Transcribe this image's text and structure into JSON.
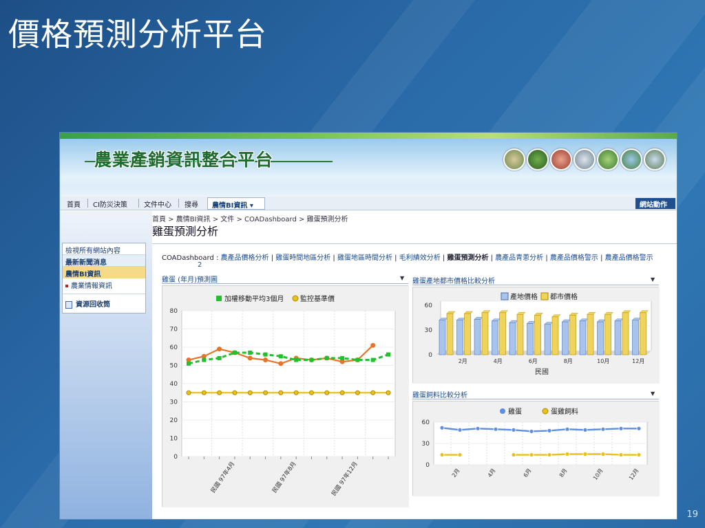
{
  "slide": {
    "title": "價格預測分析平台",
    "page_number": "19"
  },
  "site": {
    "title": "農業產銷資訊整合平台",
    "site_actions_label": "網站動作",
    "nav": [
      "首頁",
      "CI防災決策",
      "文件中心",
      "搜尋"
    ],
    "nav_active": "農情BI資訊 ▾"
  },
  "quicklaunch": {
    "view_all": "檢視所有網站內容",
    "latest_news": "最新新聞消息",
    "bi_info": "農情BI資訊",
    "bi_sub": "農業情報資訊",
    "recycle": "資源回收筒"
  },
  "page": {
    "breadcrumb": "首頁 > 農情BI資訊 > 文件 > COADashboard > 雞蛋預測分析",
    "title": "雞蛋預測分析"
  },
  "coa_bar": {
    "prefix": "COADashboard :",
    "links": [
      "農產品價格分析",
      "雞蛋時間地區分析",
      "雞蛋地區時間分析",
      "毛利績效分析",
      "雞蛋預測分析",
      "農產品青蔥分析",
      "農產品價格警示",
      "農產品價格警示"
    ],
    "current_index": 4,
    "overflow": "2"
  },
  "icons": {
    "dropdown": "chevron-down-icon",
    "recycle": "recycle-bin-icon",
    "bullet": "bullet-icon"
  },
  "colors": {
    "green": "#22c02c",
    "orange": "#e6742a",
    "gold": "#e8c21a",
    "blue": "#5e8ee0",
    "bar_blue": "#a9c3ef",
    "bar_gold": "#f0d35a"
  },
  "webparts": {
    "forecast_title": "雞蛋 (年月)預測圖",
    "price_compare_title": "雞蛋產地都市價格比較分析",
    "feed_compare_title": "雞蛋飼料比較分析"
  },
  "chart_data": [
    {
      "type": "line",
      "title": "",
      "legend": [
        "加權移動平均3個月",
        "監控基準價"
      ],
      "x_labels": [
        "民國 97年4月",
        "民國 97年8月",
        "民國 97年12月"
      ],
      "ylim": [
        0,
        80
      ],
      "yticks": [
        0,
        10,
        20,
        30,
        40,
        50,
        60,
        70,
        80
      ],
      "series": [
        {
          "name": "",
          "color": "#e6742a",
          "values": [
            53,
            55,
            59,
            57,
            54,
            53,
            51,
            54,
            53,
            54,
            52,
            53,
            61
          ]
        },
        {
          "name": "加權移動平均3個月",
          "color": "#22c02c",
          "dashed": true,
          "values": [
            51,
            53,
            54,
            57,
            57,
            56,
            55,
            53,
            53,
            54,
            54,
            53,
            53,
            56
          ]
        },
        {
          "name": "監控基準價",
          "color": "#e8c21a",
          "values": [
            35,
            35,
            35,
            35,
            35,
            35,
            35,
            35,
            35,
            35,
            35,
            35,
            35,
            35
          ]
        }
      ]
    },
    {
      "type": "bar",
      "title": "",
      "legend": [
        "產地價格",
        "都市價格"
      ],
      "xlabel": "民國",
      "x_tick_labels": [
        "2月",
        "4月",
        "6月",
        "8月",
        "10月",
        "12月"
      ],
      "categories": [
        "1月",
        "2月",
        "3月",
        "4月",
        "5月",
        "6月",
        "7月",
        "8月",
        "9月",
        "10月",
        "11月",
        "12月"
      ],
      "ylim": [
        0,
        60
      ],
      "yticks": [
        0,
        30,
        60
      ],
      "series": [
        {
          "name": "產地價格",
          "values": [
            42,
            42,
            43,
            41,
            39,
            38,
            37,
            40,
            41,
            40,
            41,
            42
          ]
        },
        {
          "name": "都市價格",
          "values": [
            50,
            50,
            51,
            51,
            49,
            48,
            46,
            48,
            49,
            49,
            51,
            51
          ]
        }
      ]
    },
    {
      "type": "line",
      "title": "",
      "legend": [
        "雞蛋",
        "蛋雞飼料"
      ],
      "x_tick_labels": [
        "2月",
        "4月",
        "6月",
        "8月",
        "10月",
        "12月"
      ],
      "ylim": [
        0,
        60
      ],
      "yticks": [
        0,
        30,
        60
      ],
      "series": [
        {
          "name": "雞蛋",
          "color": "#5e8ee0",
          "values": [
            52,
            49,
            51,
            50,
            49,
            47,
            48,
            50,
            49,
            50,
            51,
            51
          ]
        },
        {
          "name": "蛋雞飼料",
          "color": "#e8c21a",
          "values": [
            14,
            14,
            null,
            null,
            14,
            14,
            14,
            15,
            15,
            15,
            14,
            14
          ]
        }
      ]
    }
  ]
}
